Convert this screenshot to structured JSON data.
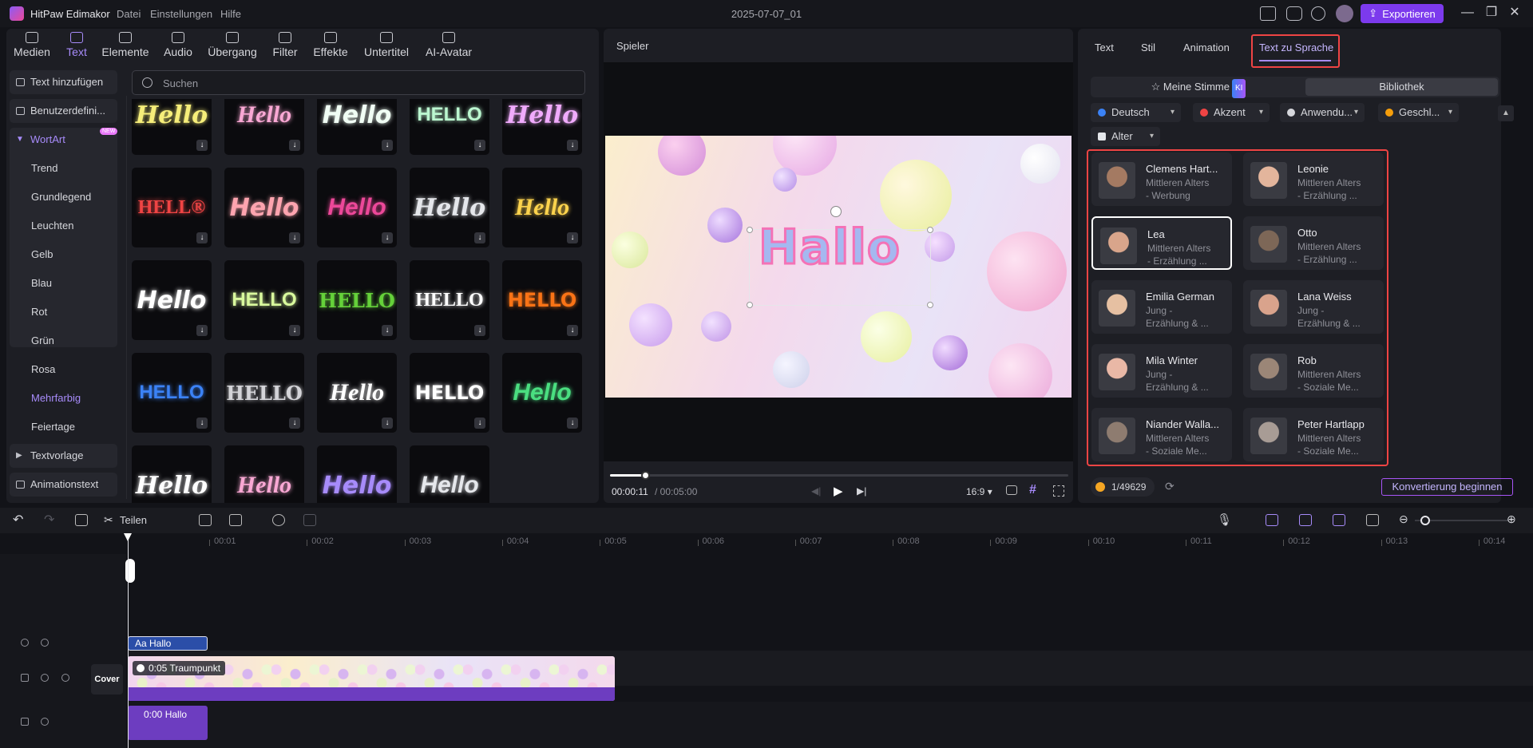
{
  "titlebar": {
    "app_name": "HitPaw Edimakor",
    "menus": [
      "Datei",
      "Einstellungen",
      "Hilfe"
    ],
    "document": "2025-07-07_01",
    "export_label": "Exportieren"
  },
  "toolbar": {
    "tools": [
      {
        "label": "Medien",
        "icon": "media-icon"
      },
      {
        "label": "Text",
        "icon": "text-icon",
        "active": true
      },
      {
        "label": "Elemente",
        "icon": "elements-icon"
      },
      {
        "label": "Audio",
        "icon": "audio-icon"
      },
      {
        "label": "Übergang",
        "icon": "transition-icon"
      },
      {
        "label": "Filter",
        "icon": "filter-icon"
      },
      {
        "label": "Effekte",
        "icon": "effects-icon"
      },
      {
        "label": "Untertitel",
        "icon": "subtitle-icon"
      },
      {
        "label": "AI-Avatar",
        "icon": "avatar-icon"
      }
    ]
  },
  "categories": {
    "add_text": "Text hinzufügen",
    "custom": "Benutzerdefini...",
    "wordart": "WortArt",
    "new_badge": "NEW",
    "items": [
      "Trend",
      "Grundlegend",
      "Leuchten",
      "Gelb",
      "Blau",
      "Rot",
      "Grün",
      "Rosa",
      "Mehrfarbig",
      "Feiertage"
    ],
    "template": "Textvorlage",
    "animated": "Animationstext"
  },
  "search": {
    "placeholder": "Suchen"
  },
  "wordart_tiles": [
    {
      "text": "Hello",
      "color": "#f6ee7a"
    },
    {
      "text": "Hello",
      "color": "#f9a8d4"
    },
    {
      "text": "Hello",
      "color": "#f0fdf4"
    },
    {
      "text": "HELLO",
      "color": "#bbf7d0"
    },
    {
      "text": "Hello",
      "color": "#f0abfc"
    },
    {
      "text": "HELL®",
      "color": "#ef4444"
    },
    {
      "text": "Hello",
      "color": "#fda4af"
    },
    {
      "text": "Hello",
      "color": "#ec4899"
    },
    {
      "text": "Hello",
      "color": "#e5e7eb"
    },
    {
      "text": "Hello",
      "color": "#fcd34d"
    },
    {
      "text": "Hello",
      "color": "#fff"
    },
    {
      "text": "HELLO",
      "color": "#d9f99d"
    },
    {
      "text": "HELLO",
      "color": "#65d13a"
    },
    {
      "text": "HELLO",
      "color": "#ffffff"
    },
    {
      "text": "HELLO",
      "color": "#f97316"
    },
    {
      "text": "HELLO",
      "color": "#3b82f6"
    },
    {
      "text": "HELLO",
      "color": "#d4d4d8"
    },
    {
      "text": "Hello",
      "color": "#ffffff"
    },
    {
      "text": "HELLO",
      "color": "#ffffff"
    },
    {
      "text": "Hello",
      "color": "#4ade80"
    },
    {
      "text": "Hello",
      "color": "#ffffff"
    },
    {
      "text": "Hello",
      "color": "#f9a8d4"
    },
    {
      "text": "Hello",
      "color": "#a78bfa"
    },
    {
      "text": "Hello",
      "color": "#e5e7eb"
    }
  ],
  "player": {
    "label": "Spieler",
    "overlay_text": "Hallo",
    "time_current": "00:00:11",
    "time_total": "/ 00:05:00",
    "progress": 0.077,
    "aspect": "16:9"
  },
  "right": {
    "tabs": [
      "Text",
      "Stil",
      "Animation",
      "Text zu Sprache"
    ],
    "active_tab": "Text zu Sprache",
    "toggle_my_voice": "Meine Stimme",
    "ki_badge": "KI",
    "toggle_library": "Bibliothek",
    "filters": [
      "Deutsch",
      "Akzent",
      "Anwendu...",
      "Geschl...",
      "Alter"
    ],
    "voices": [
      {
        "name": "Clemens Hart...",
        "line1": "Mittleren Alters",
        "line2": "- Werbung",
        "skin": "#a47a62"
      },
      {
        "name": "Leonie",
        "line1": "Mittleren Alters",
        "line2": "- Erzählung ...",
        "skin": "#e3b59c"
      },
      {
        "name": "Lea",
        "line1": "Mittleren Alters",
        "line2": "- Erzählung ...",
        "skin": "#d9a58b",
        "selected": true
      },
      {
        "name": "Otto",
        "line1": "Mittleren Alters",
        "line2": "- Erzählung ...",
        "skin": "#7d6757"
      },
      {
        "name": "Emilia German",
        "line1": "Jung -",
        "line2": "Erzählung & ...",
        "skin": "#e6c0a2"
      },
      {
        "name": "Lana Weiss",
        "line1": "Jung -",
        "line2": "Erzählung & ...",
        "skin": "#d9a38c"
      },
      {
        "name": "Mila Winter",
        "line1": "Jung -",
        "line2": "Erzählung & ...",
        "skin": "#e9b8a6"
      },
      {
        "name": "Rob",
        "line1": "Mittleren Alters",
        "line2": "- Soziale Me...",
        "skin": "#9b8677"
      },
      {
        "name": "Niander Walla...",
        "line1": "Mittleren Alters",
        "line2": "- Soziale Me...",
        "skin": "#8e7c70"
      },
      {
        "name": "Peter Hartlapp",
        "line1": "Mittleren Alters",
        "line2": "- Soziale Me...",
        "skin": "#a89c95"
      }
    ],
    "credits": "1/49629",
    "convert_label": "Konvertierung beginnen"
  },
  "timeline": {
    "split_label": "Teilen",
    "ticks": [
      "00:01",
      "00:02",
      "00:03",
      "00:04",
      "00:05",
      "00:06",
      "00:07",
      "00:08",
      "00:09",
      "00:10",
      "00:11",
      "00:12",
      "00:13",
      "00:14"
    ],
    "text_clip": "Aa Hallo",
    "video_clip": "0:05 Traumpunkt",
    "audio_clip": "0:00 Hallo",
    "cover_label": "Cover"
  }
}
